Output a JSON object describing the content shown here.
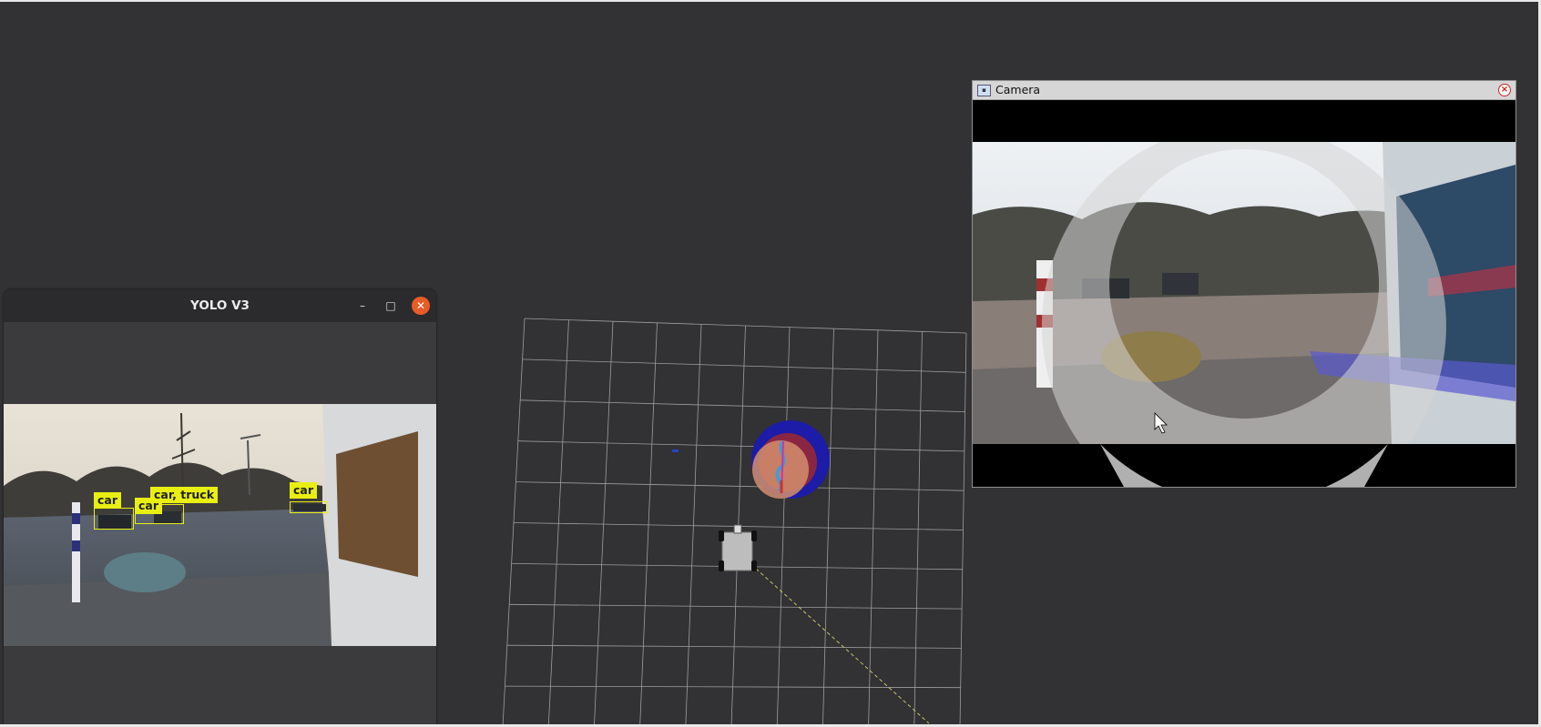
{
  "yolo_window": {
    "title": "YOLO V3",
    "minimize_glyph": "–",
    "maximize_glyph": "□",
    "close_glyph": "✕",
    "detections": [
      {
        "label": "car"
      },
      {
        "label": "car"
      },
      {
        "label": "car, truck"
      },
      {
        "label": "car"
      }
    ]
  },
  "camera_window": {
    "title": "Camera",
    "close_glyph": "×"
  },
  "rviz": {
    "grid": "on",
    "robot": "rover",
    "colors": {
      "grid": "#9e9e9e",
      "background": "#323133",
      "path": "#c7c36a",
      "marker_blue": "#1c1ca8",
      "marker_red": "#a2262a",
      "marker_orange": "#d48e6c"
    }
  },
  "colors": {
    "detection_label": "#e9ef12",
    "yolo_close_button": "#e75c26",
    "camera_titlebar": "#d6d6d6"
  }
}
